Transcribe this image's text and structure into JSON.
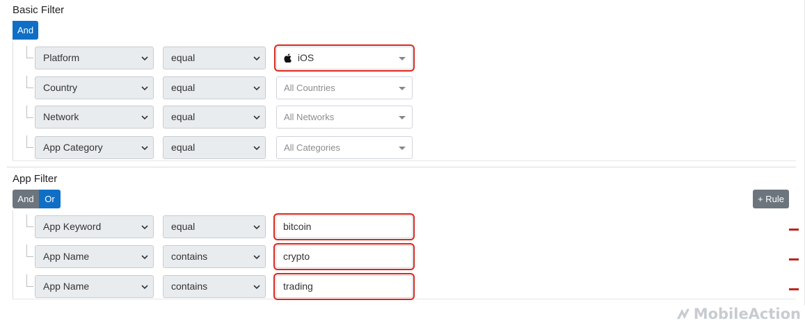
{
  "basic_filter": {
    "title": "Basic Filter",
    "conjunction": "And",
    "rules": [
      {
        "field": "Platform",
        "operator": "equal",
        "value": "iOS",
        "value_icon": "apple-icon",
        "is_placeholder": false,
        "highlighted": true
      },
      {
        "field": "Country",
        "operator": "equal",
        "value": "All Countries",
        "is_placeholder": true,
        "highlighted": false
      },
      {
        "field": "Network",
        "operator": "equal",
        "value": "All Networks",
        "is_placeholder": true,
        "highlighted": false
      },
      {
        "field": "App Category",
        "operator": "equal",
        "value": "All Categories",
        "is_placeholder": true,
        "highlighted": false
      }
    ]
  },
  "app_filter": {
    "title": "App Filter",
    "conjunctions": [
      "And",
      "Or"
    ],
    "selected_conjunction": "Or",
    "add_rule_label": "+ Rule",
    "rules": [
      {
        "field": "App Keyword",
        "operator": "equal",
        "value": "bitcoin",
        "highlighted": true
      },
      {
        "field": "App Name",
        "operator": "contains",
        "value": "crypto",
        "highlighted": true
      },
      {
        "field": "App Name",
        "operator": "contains",
        "value": "trading",
        "highlighted": true
      }
    ]
  },
  "watermark": "MobileAction",
  "colors": {
    "primary": "#0f6fc6",
    "secondary": "#6c757d",
    "highlight": "#d9261c",
    "remove": "#c0231b"
  }
}
